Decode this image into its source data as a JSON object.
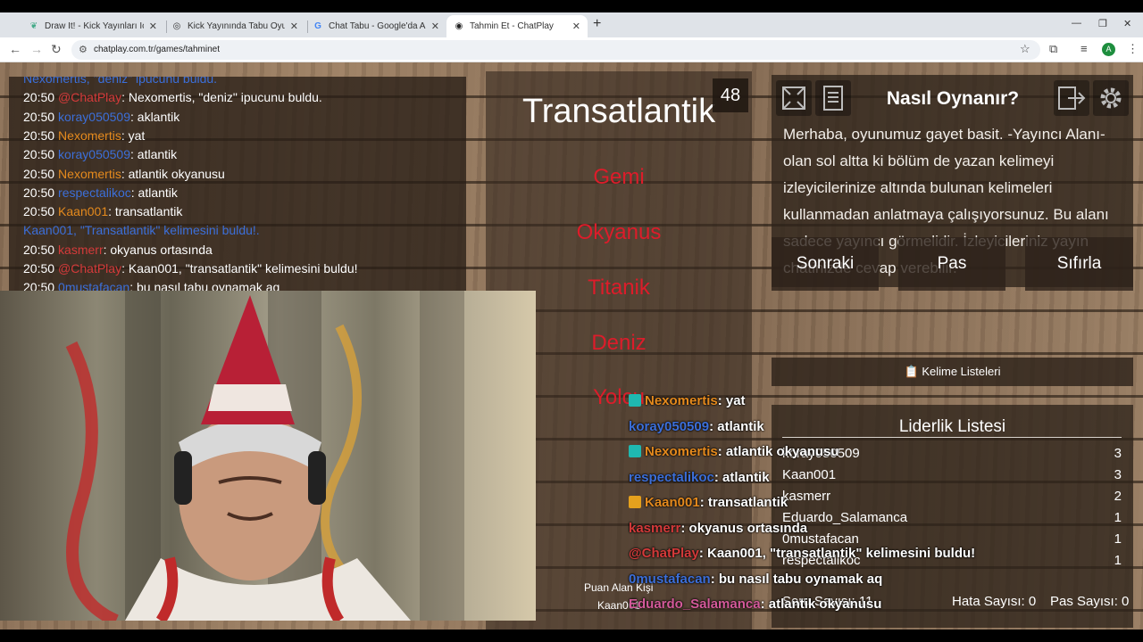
{
  "browser": {
    "tabs": [
      {
        "title": "Draw It! - Kick Yayınları İçin Çizi",
        "active": false
      },
      {
        "title": "Kick Yayınında Tabu Oyunu",
        "active": false
      },
      {
        "title": "Chat Tabu - Google'da Ara",
        "active": false
      },
      {
        "title": "Tahmin Et - ChatPlay",
        "active": true
      }
    ],
    "url": "chatplay.com.tr/games/tahminet",
    "avatar_letter": "A"
  },
  "chat": {
    "lines": [
      {
        "time": "",
        "user": "Nexomertis,",
        "user_color": "#3c6fd9",
        "text": "\"deniz\" ipucunu buldu.",
        "text_color": "#3c6fd9"
      },
      {
        "time": "20:50",
        "user": "@ChatPlay",
        "user_color": "#d43a3a",
        "text": ": Nexomertis, \"deniz\" ipucunu buldu.",
        "text_color": "#ffffff"
      },
      {
        "time": "20:50",
        "user": "koray050509",
        "user_color": "#3c6fd9",
        "text": ": aklantik",
        "text_color": "#ffffff"
      },
      {
        "time": "20:50",
        "user": "Nexomertis",
        "user_color": "#e58a1d",
        "text": ": yat",
        "text_color": "#ffffff"
      },
      {
        "time": "20:50",
        "user": "koray050509",
        "user_color": "#3c6fd9",
        "text": ": atlantik",
        "text_color": "#ffffff"
      },
      {
        "time": "20:50",
        "user": "Nexomertis",
        "user_color": "#e58a1d",
        "text": ": atlantik okyanusu",
        "text_color": "#ffffff"
      },
      {
        "time": "20:50",
        "user": "respectalikoc",
        "user_color": "#3c6fd9",
        "text": ": atlantik",
        "text_color": "#ffffff"
      },
      {
        "time": "20:50",
        "user": "Kaan001",
        "user_color": "#e58a1d",
        "text": ": transatlantik",
        "text_color": "#ffffff"
      },
      {
        "time": "",
        "user": "Kaan001, \"Transatlantik\" kelimesini buldu!.",
        "user_color": "#3c6fd9",
        "text": "",
        "text_color": "#ffffff"
      },
      {
        "time": "20:50",
        "user": "kasmerr",
        "user_color": "#d43a3a",
        "text": ": okyanus ortasında",
        "text_color": "#ffffff"
      },
      {
        "time": "20:50",
        "user": "@ChatPlay",
        "user_color": "#d43a3a",
        "text": ": Kaan001, \"transatlantik\" kelimesini buldu!",
        "text_color": "#ffffff"
      },
      {
        "time": "20:50",
        "user": "0mustafacan",
        "user_color": "#3c6fd9",
        "text": ": bu nasıl tabu oynamak aq",
        "text_color": "#ffffff"
      }
    ]
  },
  "game": {
    "word": "Transatlantik",
    "timer": "48",
    "forbidden": [
      "Gemi",
      "Okyanus",
      "Titanik",
      "Deniz",
      "Yolcu"
    ]
  },
  "howto": {
    "title": "Nasıl Oynanır?",
    "text": "Merhaba, oyunumuz gayet basit. -Yayıncı Alanı- olan sol altta ki bölüm de yazan kelimeyi izleyicilerinize altında bulunan kelimeleri kullanmadan anlatmaya çalışıyorsunuz. Bu alanı sadece yayıncı görmelidir. İzleyicileriniz yayın chatinizde cevap verebilir."
  },
  "actions": {
    "next": "Sonraki",
    "pass": "Pas",
    "reset": "Sıfırla",
    "wordlists": "📋 Kelime Listeleri"
  },
  "leaderboard": {
    "title": "Liderlik Listesi",
    "rows": [
      {
        "name": "koray050509",
        "score": "3"
      },
      {
        "name": "Kaan001",
        "score": "3"
      },
      {
        "name": "kasmerr",
        "score": "2"
      },
      {
        "name": "Eduardo_Salamanca",
        "score": "1"
      },
      {
        "name": "0mustafacan",
        "score": "1"
      },
      {
        "name": "respectalikoc",
        "score": "1"
      }
    ],
    "round_count": "Soru Sayısı: 11",
    "error_count": "Hata Sayısı: 0",
    "pass_count": "Pas Sayısı: 0"
  },
  "score_panel": {
    "header": "Puan Alan Kişi",
    "value": "Kaan001"
  },
  "overlay_chat": [
    {
      "user": "Nexomertis",
      "user_color": "#e58a1d",
      "text": ": yat",
      "badge": "#1fb8b0"
    },
    {
      "user": "koray050509",
      "user_color": "#3c6fd9",
      "text": ": atlantik",
      "badge": ""
    },
    {
      "user": "Nexomertis",
      "user_color": "#e58a1d",
      "text": ": atlantik okyanusu",
      "badge": "#1fb8b0"
    },
    {
      "user": "respectalikoc",
      "user_color": "#3c6fd9",
      "text": ": atlantik",
      "badge": ""
    },
    {
      "user": "Kaan001",
      "user_color": "#e58a1d",
      "text": ": transatlantik",
      "badge": "#e5a11d"
    },
    {
      "user": "kasmerr",
      "user_color": "#d43a3a",
      "text": ": okyanus ortasında",
      "badge": ""
    },
    {
      "user": "@ChatPlay",
      "user_color": "#d43a3a",
      "text": ": Kaan001, \"transatlantik\" kelimesini buldu!",
      "badge": ""
    },
    {
      "user": "0mustafacan",
      "user_color": "#3c6fd9",
      "text": ": bu nasıl tabu oynamak aq",
      "badge": ""
    },
    {
      "user": "Eduardo_Salamanca",
      "user_color": "#d45a9a",
      "text": ": atlantik okyanusu",
      "badge": ""
    }
  ]
}
